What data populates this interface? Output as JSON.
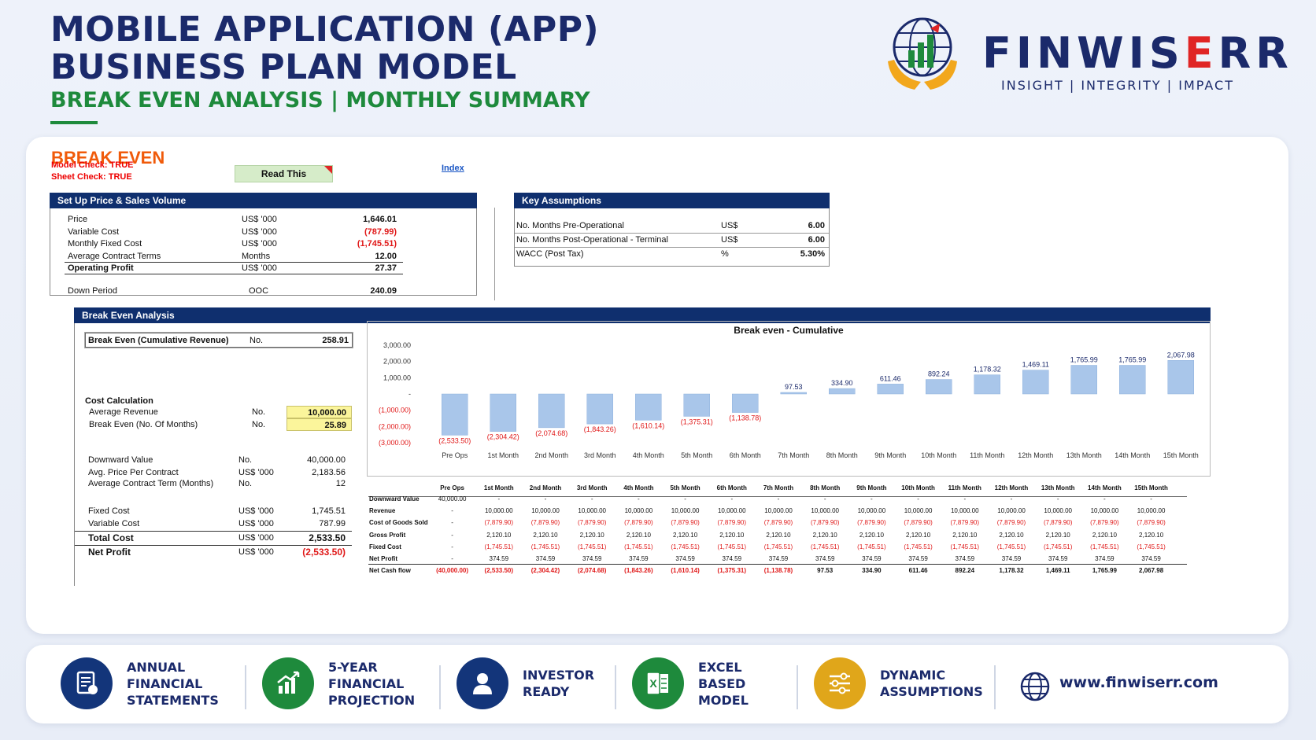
{
  "header": {
    "title_line1": "MOBILE APPLICATION (APP)",
    "title_line2": "BUSINESS PLAN MODEL",
    "subtitle": "BREAK EVEN ANALYSIS | MONTHLY SUMMARY",
    "brand_a": "FINWIS",
    "brand_e": "E",
    "brand_b": "RR",
    "tagline": "INSIGHT | INTEGRITY | IMPACT"
  },
  "sheet": {
    "title": "BREAK EVEN",
    "model_check": "Model Check: TRUE",
    "sheet_check": "Sheet Check: TRUE",
    "read_this": "Read This",
    "index": "Index",
    "setup": {
      "header": "Set Up Price & Sales Volume",
      "rows": [
        {
          "label": "Price",
          "unit": "US$ '000",
          "value": "1,646.01",
          "neg": false,
          "bold": false
        },
        {
          "label": "Variable Cost",
          "unit": "US$ '000",
          "value": "(787.99)",
          "neg": true,
          "bold": false
        },
        {
          "label": "Monthly Fixed Cost",
          "unit": "US$ '000",
          "value": "(1,745.51)",
          "neg": true,
          "bold": false
        },
        {
          "label": "Average Contract Terms",
          "unit": "Months",
          "value": "12.00",
          "neg": false,
          "bold": false
        },
        {
          "label": "Operating Profit",
          "unit": "US$ '000",
          "value": "27.37",
          "neg": false,
          "bold": true
        }
      ],
      "down_label": "Down Period",
      "down_unit": "OOC",
      "down_value": "240.09"
    },
    "assumptions": {
      "header": "Key Assumptions",
      "rows": [
        {
          "label": "No. Months Pre-Operational",
          "unit": "US$",
          "value": "6.00"
        },
        {
          "label": "No. Months Post-Operational - Terminal",
          "unit": "US$",
          "value": "6.00"
        },
        {
          "label": "WACC (Post Tax)",
          "unit": "%",
          "value": "5.30%"
        }
      ]
    },
    "analysis": {
      "header": "Break Even Analysis",
      "be_label": "Break Even (Cumulative Revenue)",
      "be_unit": "No.",
      "be_value": "258.91",
      "cost_calc_title": "Cost Calculation",
      "avg_rev_label": "Average Revenue",
      "avg_rev_unit": "No.",
      "avg_rev_value": "10,000.00",
      "be_months_label": "Break Even (No. Of Months)",
      "be_months_unit": "No.",
      "be_months_value": "25.89",
      "lower_rows": [
        {
          "label": "Downward Value",
          "unit": "No.",
          "value": "40,000.00",
          "neg": false,
          "bold": false
        },
        {
          "label": "Avg. Price Per Contract",
          "unit": "US$ '000",
          "value": "2,183.56",
          "neg": false,
          "bold": false
        },
        {
          "label": "Average Contract Term (Months)",
          "unit": "No.",
          "value": "12",
          "neg": false,
          "bold": false
        },
        {
          "label": "Fixed Cost",
          "unit": "US$ '000",
          "value": "1,745.51",
          "neg": false,
          "bold": false
        },
        {
          "label": "Variable Cost",
          "unit": "US$ '000",
          "value": "787.99",
          "neg": false,
          "bold": false
        },
        {
          "label": "Total Cost",
          "unit": "US$ '000",
          "value": "2,533.50",
          "neg": false,
          "bold": true
        },
        {
          "label": "Net Profit",
          "unit": "US$ '000",
          "value": "(2,533.50)",
          "neg": true,
          "bold": true
        }
      ]
    },
    "table": {
      "columns": [
        "Pre Ops",
        "1st Month",
        "2nd Month",
        "3rd Month",
        "4th Month",
        "5th Month",
        "6th Month",
        "7th Month",
        "8th Month",
        "9th Month",
        "10th Month",
        "11th Month",
        "12th Month",
        "13th Month",
        "14th Month",
        "15th Month"
      ],
      "rows": [
        {
          "label": "Downward Value",
          "values": [
            "40,000.00",
            "-",
            "-",
            "-",
            "-",
            "-",
            "-",
            "-",
            "-",
            "-",
            "-",
            "-",
            "-",
            "-",
            "-",
            "-"
          ],
          "bold": false
        },
        {
          "label": "Revenue",
          "values": [
            "-",
            "10,000.00",
            "10,000.00",
            "10,000.00",
            "10,000.00",
            "10,000.00",
            "10,000.00",
            "10,000.00",
            "10,000.00",
            "10,000.00",
            "10,000.00",
            "10,000.00",
            "10,000.00",
            "10,000.00",
            "10,000.00",
            "10,000.00"
          ],
          "bold": false
        },
        {
          "label": "Cost of Goods Sold",
          "values": [
            "-",
            "(7,879.90)",
            "(7,879.90)",
            "(7,879.90)",
            "(7,879.90)",
            "(7,879.90)",
            "(7,879.90)",
            "(7,879.90)",
            "(7,879.90)",
            "(7,879.90)",
            "(7,879.90)",
            "(7,879.90)",
            "(7,879.90)",
            "(7,879.90)",
            "(7,879.90)",
            "(7,879.90)"
          ],
          "bold": false
        },
        {
          "label": "Gross Profit",
          "values": [
            "-",
            "2,120.10",
            "2,120.10",
            "2,120.10",
            "2,120.10",
            "2,120.10",
            "2,120.10",
            "2,120.10",
            "2,120.10",
            "2,120.10",
            "2,120.10",
            "2,120.10",
            "2,120.10",
            "2,120.10",
            "2,120.10",
            "2,120.10"
          ],
          "bold": false
        },
        {
          "label": "Fixed Cost",
          "values": [
            "-",
            "(1,745.51)",
            "(1,745.51)",
            "(1,745.51)",
            "(1,745.51)",
            "(1,745.51)",
            "(1,745.51)",
            "(1,745.51)",
            "(1,745.51)",
            "(1,745.51)",
            "(1,745.51)",
            "(1,745.51)",
            "(1,745.51)",
            "(1,745.51)",
            "(1,745.51)",
            "(1,745.51)"
          ],
          "bold": false
        },
        {
          "label": "Net Profit",
          "values": [
            "-",
            "374.59",
            "374.59",
            "374.59",
            "374.59",
            "374.59",
            "374.59",
            "374.59",
            "374.59",
            "374.59",
            "374.59",
            "374.59",
            "374.59",
            "374.59",
            "374.59",
            "374.59"
          ],
          "bold": false
        },
        {
          "label": "Net Cash flow",
          "values": [
            "(40,000.00)",
            "(2,533.50)",
            "(2,304.42)",
            "(2,074.68)",
            "(1,843.26)",
            "(1,610.14)",
            "(1,375.31)",
            "(1,138.78)",
            "97.53",
            "334.90",
            "611.46",
            "892.24",
            "1,178.32",
            "1,469.11",
            "1,765.99",
            "2,067.98"
          ],
          "bold": true
        }
      ]
    }
  },
  "chart_data": {
    "type": "bar",
    "title": "Break even - Cumulative",
    "categories": [
      "Pre Ops",
      "1st Month",
      "2nd Month",
      "3rd Month",
      "4th Month",
      "5th Month",
      "6th Month",
      "7th Month",
      "8th Month",
      "9th Month",
      "10th Month",
      "11th Month",
      "12th Month",
      "13th Month",
      "14th Month",
      "15th Month"
    ],
    "values": [
      -2533.5,
      -2304.42,
      -2074.68,
      -1843.26,
      -1610.14,
      -1375.31,
      -1138.78,
      97.53,
      334.9,
      611.46,
      892.24,
      1178.32,
      1469.11,
      1765.99,
      1765.99,
      2067.98
    ],
    "labels": [
      "(2,533.50)",
      "(2,304.42)",
      "(2,074.68)",
      "(1,843.26)",
      "(1,610.14)",
      "(1,375.31)",
      "(1,138.78)",
      "97.53",
      "334.90",
      "611.46",
      "892.24",
      "1,178.32",
      "1,469.11",
      "1,765.99",
      "1,765.99",
      "2,067.98"
    ],
    "yticks": [
      "3,000.00",
      "2,000.00",
      "1,000.00",
      "-",
      "(1,000.00)",
      "(2,000.00)",
      "(3,000.00)"
    ],
    "ylim": [
      -3000,
      3000
    ],
    "bar_color": "#a9c6ea",
    "neg_label_color": "#e01818"
  },
  "footer": {
    "features": [
      {
        "text": "ANNUAL\nFINANCIAL\nSTATEMENTS",
        "icon": "statements-icon",
        "color": "#13357a"
      },
      {
        "text": "5-YEAR\nFINANCIAL\nPROJECTION",
        "icon": "growth-chart-icon",
        "color": "#1e8a3c"
      },
      {
        "text": "INVESTOR\nREADY",
        "icon": "investor-icon",
        "color": "#13357a"
      },
      {
        "text": "EXCEL\nBASED\nMODEL",
        "icon": "excel-icon",
        "color": "#1e8a3c"
      },
      {
        "text": "DYNAMIC\nASSUMPTIONS",
        "icon": "sliders-icon",
        "color": "#e0a61a"
      }
    ],
    "website": "www.finwiserr.com"
  }
}
